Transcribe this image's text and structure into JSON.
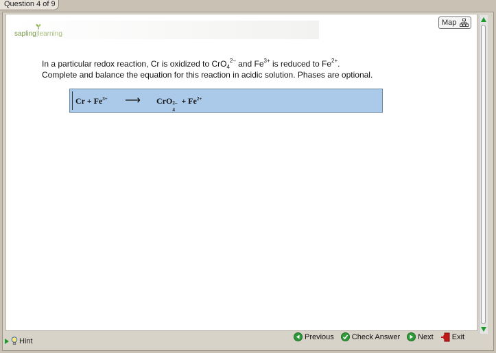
{
  "tab": {
    "label": "Question 4 of 9"
  },
  "logo": {
    "sapling": "sapling",
    "learning": "learning"
  },
  "map_button": {
    "label": "Map"
  },
  "problem": {
    "line1_a": "In a particular redox reaction, Cr is oxidized to CrO",
    "line1_sub": "4",
    "line1_sup1": "2–",
    "line1_b": " and Fe",
    "line1_sup2": "3+",
    "line1_c": " is reduced to Fe",
    "line1_sup3": "2+",
    "line1_d": ".",
    "line2": "Complete and balance the equation for this reaction in acidic solution. Phases are optional."
  },
  "equation": {
    "reactants": "Cr + Fe",
    "reactant_charge": "3+",
    "arrow": "⟶",
    "product1": "CrO",
    "product1_charge": "2–",
    "product1_sub": "4",
    "product2": " + Fe",
    "product2_charge": "2+"
  },
  "bottom": {
    "hint": "Hint",
    "previous": "Previous",
    "check_answer": "Check Answer",
    "next": "Next",
    "exit": "Exit"
  },
  "colors": {
    "equation_bg": "#abc9e8",
    "brand_green": "#7a9a4a",
    "check_green": "#3a9a2a",
    "exit_red": "#c01818"
  }
}
